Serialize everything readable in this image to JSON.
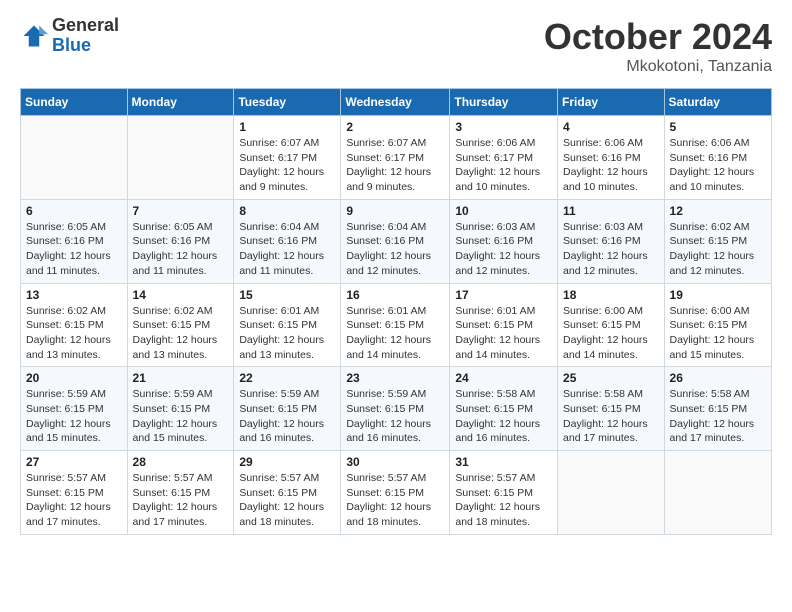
{
  "header": {
    "logo_general": "General",
    "logo_blue": "Blue",
    "month": "October 2024",
    "location": "Mkokotoni, Tanzania"
  },
  "weekdays": [
    "Sunday",
    "Monday",
    "Tuesday",
    "Wednesday",
    "Thursday",
    "Friday",
    "Saturday"
  ],
  "weeks": [
    [
      {
        "day": "",
        "info": ""
      },
      {
        "day": "",
        "info": ""
      },
      {
        "day": "1",
        "info": "Sunrise: 6:07 AM\nSunset: 6:17 PM\nDaylight: 12 hours and 9 minutes."
      },
      {
        "day": "2",
        "info": "Sunrise: 6:07 AM\nSunset: 6:17 PM\nDaylight: 12 hours and 9 minutes."
      },
      {
        "day": "3",
        "info": "Sunrise: 6:06 AM\nSunset: 6:17 PM\nDaylight: 12 hours and 10 minutes."
      },
      {
        "day": "4",
        "info": "Sunrise: 6:06 AM\nSunset: 6:16 PM\nDaylight: 12 hours and 10 minutes."
      },
      {
        "day": "5",
        "info": "Sunrise: 6:06 AM\nSunset: 6:16 PM\nDaylight: 12 hours and 10 minutes."
      }
    ],
    [
      {
        "day": "6",
        "info": "Sunrise: 6:05 AM\nSunset: 6:16 PM\nDaylight: 12 hours and 11 minutes."
      },
      {
        "day": "7",
        "info": "Sunrise: 6:05 AM\nSunset: 6:16 PM\nDaylight: 12 hours and 11 minutes."
      },
      {
        "day": "8",
        "info": "Sunrise: 6:04 AM\nSunset: 6:16 PM\nDaylight: 12 hours and 11 minutes."
      },
      {
        "day": "9",
        "info": "Sunrise: 6:04 AM\nSunset: 6:16 PM\nDaylight: 12 hours and 12 minutes."
      },
      {
        "day": "10",
        "info": "Sunrise: 6:03 AM\nSunset: 6:16 PM\nDaylight: 12 hours and 12 minutes."
      },
      {
        "day": "11",
        "info": "Sunrise: 6:03 AM\nSunset: 6:16 PM\nDaylight: 12 hours and 12 minutes."
      },
      {
        "day": "12",
        "info": "Sunrise: 6:02 AM\nSunset: 6:15 PM\nDaylight: 12 hours and 12 minutes."
      }
    ],
    [
      {
        "day": "13",
        "info": "Sunrise: 6:02 AM\nSunset: 6:15 PM\nDaylight: 12 hours and 13 minutes."
      },
      {
        "day": "14",
        "info": "Sunrise: 6:02 AM\nSunset: 6:15 PM\nDaylight: 12 hours and 13 minutes."
      },
      {
        "day": "15",
        "info": "Sunrise: 6:01 AM\nSunset: 6:15 PM\nDaylight: 12 hours and 13 minutes."
      },
      {
        "day": "16",
        "info": "Sunrise: 6:01 AM\nSunset: 6:15 PM\nDaylight: 12 hours and 14 minutes."
      },
      {
        "day": "17",
        "info": "Sunrise: 6:01 AM\nSunset: 6:15 PM\nDaylight: 12 hours and 14 minutes."
      },
      {
        "day": "18",
        "info": "Sunrise: 6:00 AM\nSunset: 6:15 PM\nDaylight: 12 hours and 14 minutes."
      },
      {
        "day": "19",
        "info": "Sunrise: 6:00 AM\nSunset: 6:15 PM\nDaylight: 12 hours and 15 minutes."
      }
    ],
    [
      {
        "day": "20",
        "info": "Sunrise: 5:59 AM\nSunset: 6:15 PM\nDaylight: 12 hours and 15 minutes."
      },
      {
        "day": "21",
        "info": "Sunrise: 5:59 AM\nSunset: 6:15 PM\nDaylight: 12 hours and 15 minutes."
      },
      {
        "day": "22",
        "info": "Sunrise: 5:59 AM\nSunset: 6:15 PM\nDaylight: 12 hours and 16 minutes."
      },
      {
        "day": "23",
        "info": "Sunrise: 5:59 AM\nSunset: 6:15 PM\nDaylight: 12 hours and 16 minutes."
      },
      {
        "day": "24",
        "info": "Sunrise: 5:58 AM\nSunset: 6:15 PM\nDaylight: 12 hours and 16 minutes."
      },
      {
        "day": "25",
        "info": "Sunrise: 5:58 AM\nSunset: 6:15 PM\nDaylight: 12 hours and 17 minutes."
      },
      {
        "day": "26",
        "info": "Sunrise: 5:58 AM\nSunset: 6:15 PM\nDaylight: 12 hours and 17 minutes."
      }
    ],
    [
      {
        "day": "27",
        "info": "Sunrise: 5:57 AM\nSunset: 6:15 PM\nDaylight: 12 hours and 17 minutes."
      },
      {
        "day": "28",
        "info": "Sunrise: 5:57 AM\nSunset: 6:15 PM\nDaylight: 12 hours and 17 minutes."
      },
      {
        "day": "29",
        "info": "Sunrise: 5:57 AM\nSunset: 6:15 PM\nDaylight: 12 hours and 18 minutes."
      },
      {
        "day": "30",
        "info": "Sunrise: 5:57 AM\nSunset: 6:15 PM\nDaylight: 12 hours and 18 minutes."
      },
      {
        "day": "31",
        "info": "Sunrise: 5:57 AM\nSunset: 6:15 PM\nDaylight: 12 hours and 18 minutes."
      },
      {
        "day": "",
        "info": ""
      },
      {
        "day": "",
        "info": ""
      }
    ]
  ]
}
